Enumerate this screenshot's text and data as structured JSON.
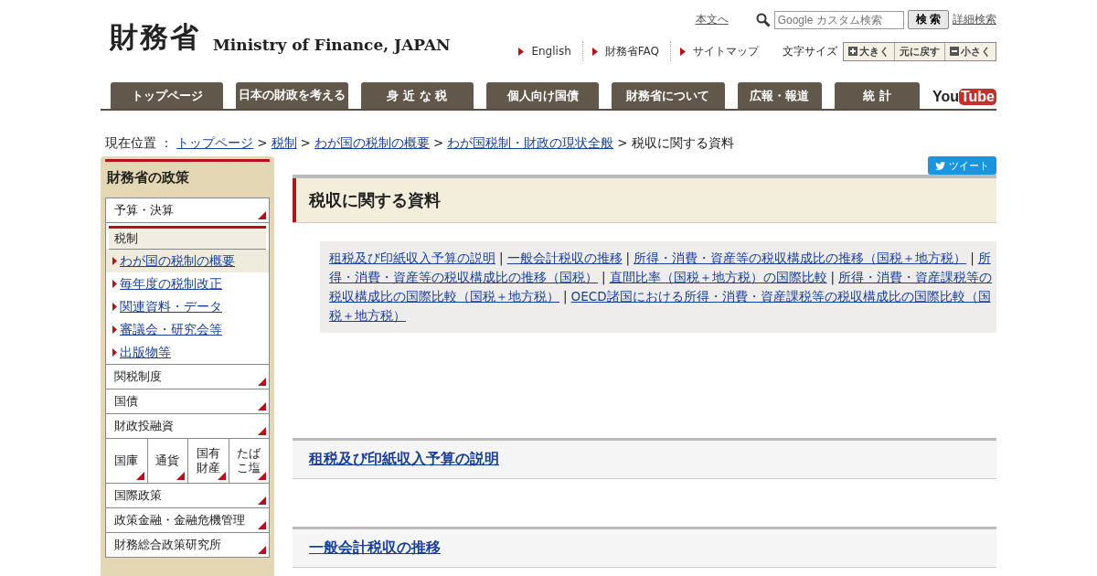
{
  "header": {
    "logo_kanji": "財務省",
    "logo_english": "Ministry of Finance, JAPAN",
    "skip_link": "本文へ",
    "search": {
      "placeholder": "Google カスタム検索",
      "button": "検 索"
    },
    "advanced_search": "詳細検索",
    "quick_links": [
      "English",
      "財務省FAQ",
      "サイトマップ"
    ],
    "font_size": {
      "label": "文字サイズ",
      "buttons": [
        {
          "label": "大きく",
          "kind": "plus"
        },
        {
          "label": "元に戻す",
          "kind": "reset"
        },
        {
          "label": "小さく",
          "kind": "minus"
        }
      ]
    }
  },
  "nav": {
    "tabs": [
      "トップページ",
      "日本の財政を考える",
      "身 近 な 税",
      "個人向け国債",
      "財務省について",
      "広報・報道",
      "統 計"
    ],
    "youtube": {
      "you": "You",
      "tube": "Tube"
    }
  },
  "breadcrumb": {
    "label": "現在位置 ：",
    "separator": ">",
    "links": [
      "トップページ",
      "税制",
      "わが国の税制の概要",
      "わが国税制・財政の現状全般"
    ],
    "current": "税収に関する資料"
  },
  "sidebar": {
    "title": "財務省の政策",
    "items": [
      {
        "kind": "link",
        "label": "予算・決算"
      },
      {
        "kind": "section",
        "label": "税制",
        "children": [
          {
            "label": "わが国の税制の概要",
            "selected": true
          },
          {
            "label": "毎年度の税制改正",
            "selected": false
          },
          {
            "label": "関連資料・データ",
            "selected": false
          },
          {
            "label": "審議会・研究会等",
            "selected": false
          },
          {
            "label": "出版物等",
            "selected": false
          }
        ]
      },
      {
        "kind": "link",
        "label": "関税制度"
      },
      {
        "kind": "link",
        "label": "国債"
      },
      {
        "kind": "link",
        "label": "財政投融資"
      },
      {
        "kind": "grid",
        "cells": [
          "国庫",
          "通貨",
          "国有財産",
          "たばこ塩"
        ]
      },
      {
        "kind": "link",
        "label": "国際政策"
      },
      {
        "kind": "link",
        "label": "政策金融・金融危機管理"
      },
      {
        "kind": "link",
        "label": "財務総合政策研究所"
      }
    ]
  },
  "main": {
    "tweet": "ツイート",
    "title": "税収に関する資料",
    "index_separator": "|",
    "index_links": [
      "租税及び印紙収入予算の説明",
      "一般会計税収の推移",
      "所得・消費・資産等の税収構成比の推移（国税＋地方税）",
      "所得・消費・資産等の税収構成比の推移（国税）",
      "直間比率（国税＋地方税）の国際比較",
      "所得・消費・資産課税等の税収構成比の国際比較（国税＋地方税）",
      "OECD諸国における所得・消費・資産課税等の税収構成比の国際比較（国税＋地方税）"
    ],
    "sections": [
      "租税及び印紙収入予算の説明",
      "一般会計税収の推移"
    ]
  }
}
